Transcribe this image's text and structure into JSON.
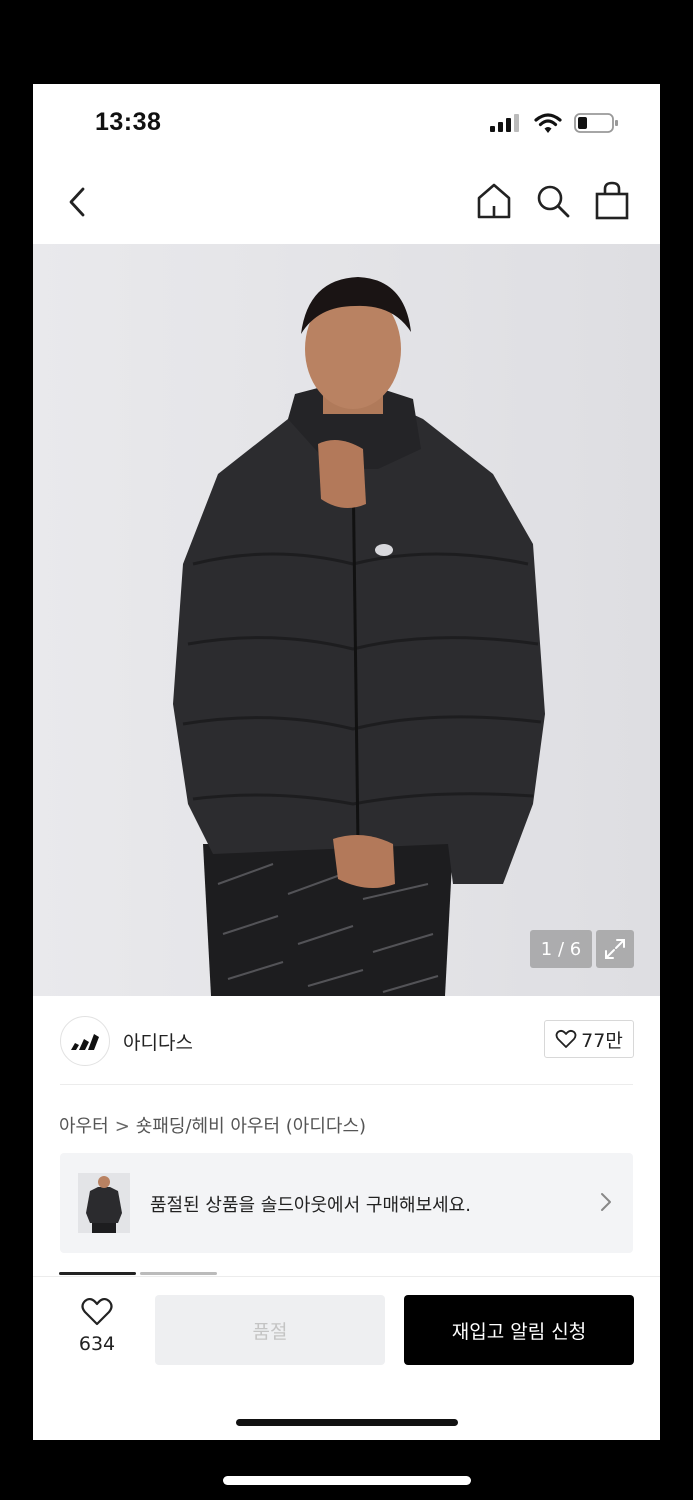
{
  "status": {
    "time": "13:38",
    "icons": [
      "cellular-signal-icon",
      "wifi-icon",
      "battery-icon"
    ]
  },
  "nav": {
    "icons": [
      "back-chevron-icon",
      "home-icon",
      "search-icon",
      "shopping-bag-icon"
    ]
  },
  "gallery": {
    "indicator": "1 / 6",
    "image": "product-photo-black-padded-jacket"
  },
  "brand": {
    "name": "아디다스",
    "likes": "77만"
  },
  "breadcrumb": {
    "category": "아우터",
    "separator": ">",
    "subcategory": "숏패딩/헤비 아우터 (아디다스)"
  },
  "soldout_banner": {
    "text": "품절된 상품을 솔드아웃에서 구매해보세요."
  },
  "bottom": {
    "wish_count": "634",
    "soldout_label": "품절",
    "restock_label": "재입고 알림 신청"
  },
  "colors": {
    "accent_black": "#000000",
    "hero_bg": "#e6e6e9",
    "disabled_bg": "#eeeff1"
  }
}
